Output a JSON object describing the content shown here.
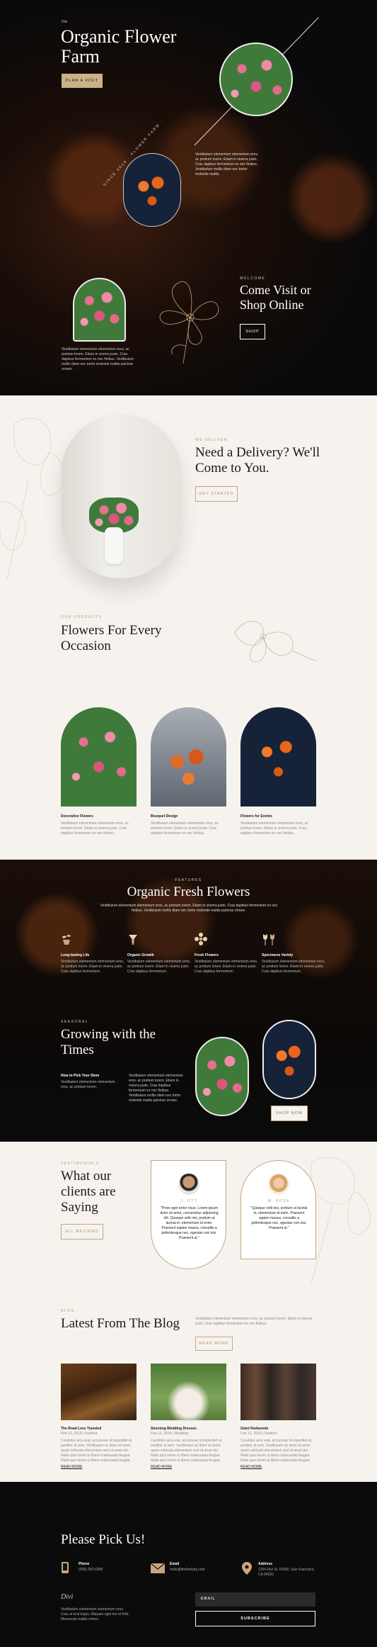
{
  "hero": {
    "logo": "Divi",
    "title": "Organic Flower Farm",
    "cta": "Plan a Visit",
    "about_text": "Vestibulum elementum elementum eros, ac pretium lorem. Etiam in viverra justo. Cras dapibus fermentum ex nec finibus. Vestibulum mollis diam nec tortor molestie mattis.",
    "badge_text": "SINCE 2010 · FLOWER FARM ·",
    "visit_eyebrow": "Welcome",
    "visit_title": "Come Visit or Shop Online",
    "visit_cta": "Shop",
    "bottom_text": "Vestibulum elementum elementum eros, ac pretium lorem. Etiam in viverra justo. Cras dapibus fermentum ex nec finibus. Vestibulum mollis diam nec tortor molestie mattis pulvinar ornare."
  },
  "delivery": {
    "eyebrow": "We Deliver",
    "title": "Need a Delivery? We'll Come to You.",
    "cta": "Get Started"
  },
  "products": {
    "eyebrow": "Our Products",
    "title": "Flowers For Every Occasion",
    "items": [
      {
        "name": "Decorative Flowers",
        "desc": "Vestibulum elementum elementum eros, ac pretium lorem. Etiam in viverra justo. Cras dapibus fermentum ex nec finibus."
      },
      {
        "name": "Bouquet Design",
        "desc": "Vestibulum elementum elementum eros, ac pretium lorem. Etiam in viverra justo. Cras dapibus fermentum ex nec finibus."
      },
      {
        "name": "Flowers for Events",
        "desc": "Vestibulum elementum elementum eros, ac pretium lorem. Etiam in viverra justo. Cras dapibus fermentum ex nec finibus."
      }
    ]
  },
  "features": {
    "eyebrow": "Features",
    "title": "Organic Fresh Flowers",
    "intro": "Vestibulum elementum elementum eros, ac pretium lorem. Etiam in viverra justo. Cras dapibus fermentum ex nec finibus. Vestibulum mollis diam nec tortor molestie mattis pulvinar ornare.",
    "items": [
      {
        "name": "Long-lasting Life",
        "desc": "Vestibulum elementum elementum eros, ac pretium lorem. Etiam in viverra justo. Cras dapibus fermentum."
      },
      {
        "name": "Organic Growth",
        "desc": "Vestibulum elementum elementum eros, ac pretium lorem. Etiam in viverra justo. Cras dapibus fermentum."
      },
      {
        "name": "Fresh Flowers",
        "desc": "Vestibulum elementum elementum eros, ac pretium lorem. Etiam in viverra justo. Cras dapibus fermentum."
      },
      {
        "name": "Specimens Variety",
        "desc": "Vestibulum elementum elementum eros, ac pretium lorem. Etiam in viverra justo. Cras dapibus fermentum."
      }
    ],
    "season_eyebrow": "Seasonal",
    "season_title": "Growing with the Times",
    "how_title": "How to Pick Your Stem",
    "how_desc": "Vestibulum elementum elementum eros, ac pretium lorem.",
    "season_text": "Vestibulum elementum elementum eros, ac pretium lorem. Etiam in viverra justo. Cras dapibus fermentum ex nec finibus. Vestibulum mollis diam nec tortor molestie mattis pulvinar ornare.",
    "shop_cta": "Shop Now"
  },
  "testimonials": {
    "eyebrow": "Testimonials",
    "title": "What our clients are Saying",
    "cta": "All Reviews",
    "items": [
      {
        "name": "J. Ott",
        "quote": "\"Proin eget tortor risus. Lorem ipsum dolor sit amet, consectetur adipiscing elit. Quisque velit nisi, pretium ut lacinia in, elementum id enim. Praesent sapien massa, convallis a pellentesque nec, egestas non nisi. Praesent ut.\""
      },
      {
        "name": "M. Rose",
        "quote": "\"Quisque velit nisi, pretium ut lacinia in, elementum id enim. Praesent sapien massa, convallis a pellentesque nec, egestas non nisi. Praesent ut.\""
      }
    ]
  },
  "blog": {
    "eyebrow": "Blog",
    "title": "Latest From The Blog",
    "intro": "Vestibulum elementum elementum eros, ac pretium lorem. Etiam in viverra justo. Cras dapibus fermentum ex nec finibus.",
    "cta": "Read More",
    "posts": [
      {
        "title": "The Road Less Traveled",
        "meta": "Feb 12, 2019 | Outdoor",
        "excerpt": "Curabitur arcu erat, accumsan id imperdiet et, porttitor at sem. Vestibulum ac diam sit amet quam vehicula elementum sed sit amet dui. Nulla quis lorem ut libero malesuada feugiat. Nulla quis lorem ut libero malesuada feugiat.",
        "more": "Read More"
      },
      {
        "title": "Stunning Wedding Dresses",
        "meta": "Feb 12, 2019 | Wedding",
        "excerpt": "Curabitur arcu erat, accumsan id imperdiet et, porttitor at sem. Vestibulum ac diam sit amet quam vehicula elementum sed sit amet dui. Nulla quis lorem ut libero malesuada feugiat. Nulla quis lorem ut libero malesuada feugiat.",
        "more": "Read More"
      },
      {
        "title": "Giant Redwoods",
        "meta": "Feb 12, 2019 | Outdoor",
        "excerpt": "Curabitur arcu erat, accumsan id imperdiet et, porttitor at sem. Vestibulum ac diam sit amet quam vehicula elementum sed sit amet dui. Nulla quis lorem ut libero malesuada feugiat. Nulla quis lorem ut libero malesuada feugiat.",
        "more": "Read More"
      }
    ]
  },
  "footer": {
    "title": "Please Pick Us!",
    "phone_label": "Phone",
    "phone": "(255) 352-6258",
    "email_label": "Email",
    "email": "hello@divifloristry.com",
    "address_label": "Address",
    "address": "1234 Divi St. #1000, San Francisco, CA 94220",
    "logo": "Divi",
    "about": "Vestibulum elementum elementum eros. Cras ut erat turpis. Aliquam eget leo et felis. Maecenas mattis metus.",
    "email_placeholder": "Email",
    "subscribe": "Subscribe"
  },
  "colors": {
    "gold": "#c9b28a",
    "accent_text": "#b89a6e",
    "cream": "#f6f3ee",
    "dark": "#0b0b0b"
  }
}
